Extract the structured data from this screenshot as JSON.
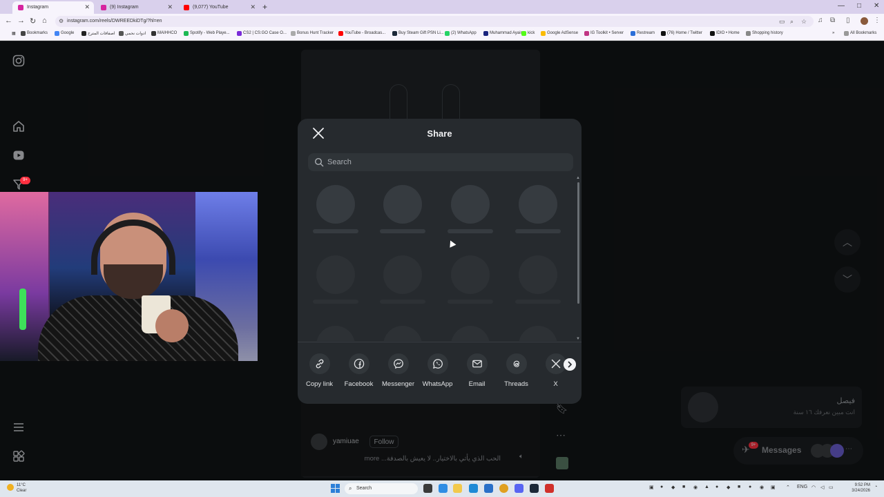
{
  "browser": {
    "tabs": [
      {
        "label": "Instagram",
        "active": true,
        "color": "#d6249f"
      },
      {
        "label": "(9) Instagram",
        "active": false,
        "color": "#d6249f"
      },
      {
        "label": "(9,077) YouTube",
        "active": false,
        "color": "#ff0000"
      }
    ],
    "url": "instagram.com/reels/DWREEDkiDTg/?hl=en",
    "bookmarks": [
      {
        "label": "Bookmarks",
        "color": "#444"
      },
      {
        "label": "Google",
        "color": "#4285f4"
      },
      {
        "label": "اصفافات المترح",
        "color": "#222"
      },
      {
        "label": "ادوات نحمي",
        "color": "#555"
      },
      {
        "label": "MAIHHCO",
        "color": "#333"
      },
      {
        "label": "Spotify - Web Playe...",
        "color": "#1db954"
      },
      {
        "label": "CS2 | CS:GO Case O...",
        "color": "#7a2bd8"
      },
      {
        "label": "Bonus Hunt Tracker",
        "color": "#aaaaaa"
      },
      {
        "label": "YouTube - Broadcas...",
        "color": "#ff0000"
      },
      {
        "label": "Buy Steam Gift PSN Li...",
        "color": "#1b2838"
      },
      {
        "label": "(2) WhatsApp",
        "color": "#25d366"
      },
      {
        "label": "Muhammad Ayais",
        "color": "#1a237e"
      },
      {
        "label": "kick",
        "color": "#53fc18"
      },
      {
        "label": "Google AdSense",
        "color": "#fbbc04"
      },
      {
        "label": "IG Toolkit • Server",
        "color": "#c13584"
      },
      {
        "label": "Restream",
        "color": "#2b6ed8"
      },
      {
        "label": "(76) Home / Twitter",
        "color": "#111"
      },
      {
        "label": "IDIO • Home",
        "color": "#111"
      },
      {
        "label": "Shopping history",
        "color": "#888"
      }
    ],
    "all_bookmarks": "All Bookmarks"
  },
  "sidebar": {
    "notification_badge": "9+"
  },
  "reel": {
    "username": "yamiuae",
    "follow_label": "Follow",
    "caption": "الحب الذي يأتي بالاختيار.. لا يعيش بالصدفة... more"
  },
  "share_modal": {
    "title": "Share",
    "search_placeholder": "Search",
    "options": [
      {
        "label": "Copy link",
        "icon": "link-icon"
      },
      {
        "label": "Facebook",
        "icon": "facebook-icon"
      },
      {
        "label": "Messenger",
        "icon": "messenger-icon"
      },
      {
        "label": "WhatsApp",
        "icon": "whatsapp-icon"
      },
      {
        "label": "Email",
        "icon": "email-icon"
      },
      {
        "label": "Threads",
        "icon": "threads-icon"
      },
      {
        "label": "X",
        "icon": "x-icon"
      }
    ]
  },
  "suggestion": {
    "name": "فيصل",
    "subtitle": "انت مبين نعرفك ١٦ سنة"
  },
  "messages": {
    "label": "Messages",
    "badge": "9+"
  },
  "taskbar": {
    "weather_temp": "11°C",
    "weather_desc": "Clear",
    "search_placeholder": "Search",
    "lang": "ENG",
    "time": "9:52 PM",
    "date": "3/24/2026"
  }
}
